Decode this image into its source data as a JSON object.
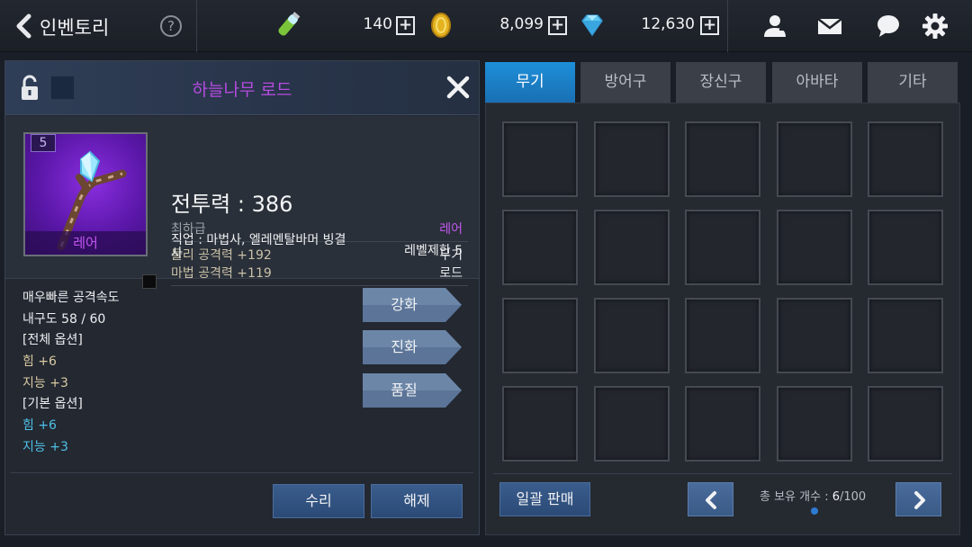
{
  "header": {
    "title": "인벤토리",
    "help_label": "?",
    "currencies": [
      {
        "icon": "stamina-potion-icon",
        "value": "140"
      },
      {
        "icon": "gold-coin-icon",
        "value": "8,099"
      },
      {
        "icon": "diamond-gem-icon",
        "value": "12,630"
      }
    ],
    "plus_label": "+"
  },
  "item": {
    "name": "하늘나무 로드",
    "level": "5",
    "rarity_badge": "레어",
    "combat_power": "전투력 : 386",
    "grade": "최하급",
    "rarity": "레어",
    "stats": [
      {
        "label": "물리 공격력 +192",
        "type": "무기"
      },
      {
        "label": "마법 공격력 +119",
        "type": "로드"
      }
    ],
    "job": "직업 : 마법사, 엘레멘탈바머 빙결사",
    "level_limit": "레벨제한 5",
    "options": [
      {
        "text": "매우빠른 공격속도",
        "style": "white"
      },
      {
        "text": "내구도 58 / 60",
        "style": "white"
      },
      {
        "text": "[전체 옵션]",
        "style": "white"
      },
      {
        "text": "힘 +6",
        "style": "gold"
      },
      {
        "text": "지능 +3",
        "style": "gold"
      },
      {
        "text": "[기본 옵션]",
        "style": "white"
      },
      {
        "text": "힘 +6",
        "style": "blue"
      },
      {
        "text": "지능 +3",
        "style": "blue"
      }
    ],
    "actions": [
      "강화",
      "진화",
      "품질"
    ],
    "repair_label": "수리",
    "unequip_label": "해제"
  },
  "inventory": {
    "tabs": [
      {
        "label": "무기",
        "active": true
      },
      {
        "label": "방어구",
        "active": false
      },
      {
        "label": "장신구",
        "active": false
      },
      {
        "label": "아바타",
        "active": false
      },
      {
        "label": "기타",
        "active": false
      }
    ],
    "bulk_sell_label": "일괄 판매",
    "count_label": "총 보유 개수 : ",
    "count_current": "6",
    "count_total": "/100"
  },
  "colors": {
    "accent_blue": "#1d8fd8",
    "rare_purple": "#c257f0",
    "option_blue": "#4ec1e6"
  }
}
